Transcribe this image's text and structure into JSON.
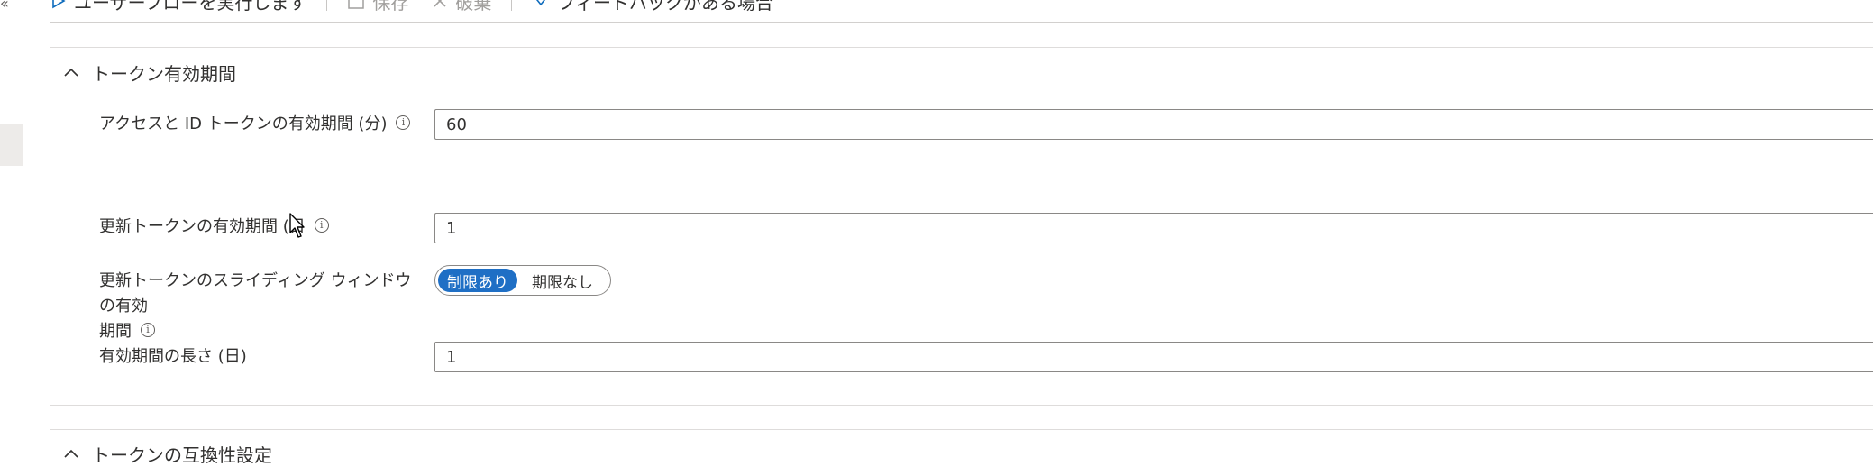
{
  "toolbar": {
    "run_user_flow": "ユーザーフローを実行します",
    "save": "保存",
    "discard": "破棄",
    "feedback": "フィードバックがある場合"
  },
  "sections": {
    "token_lifetime": {
      "title": "トークン有効期間",
      "access_id_label": "アクセスと ID トークンの有効期間 (分)",
      "access_id_value": "60",
      "refresh_label": "更新トークンの有効期間 (日",
      "refresh_value": "1",
      "sliding_label_line1": "更新トークンのスライディング ウィンドウの有効",
      "sliding_label_line2": "期間",
      "sliding_options": [
        "制限あり",
        "期限なし"
      ],
      "sliding_selected": "制限あり",
      "duration_label": "有効期間の長さ (日)",
      "duration_value": "1"
    },
    "compat": {
      "title": "トークンの互換性設定"
    }
  },
  "icons": {
    "info": "info-icon",
    "chevron": "chevron-up-icon"
  },
  "colors": {
    "accent": "#1f6fc5",
    "border": "#8a8886"
  }
}
